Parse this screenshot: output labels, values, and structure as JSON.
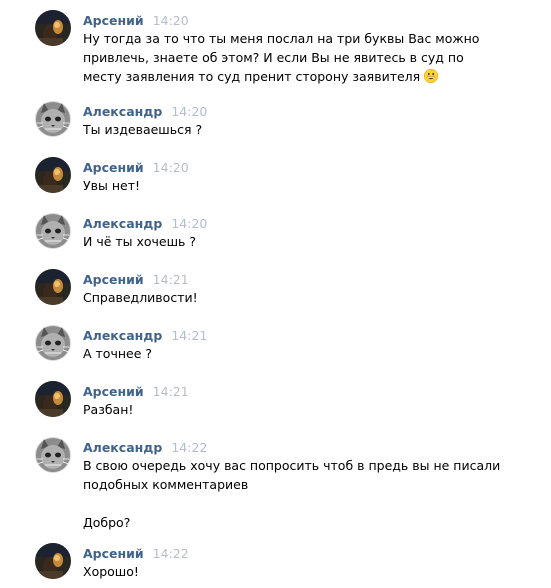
{
  "messages": [
    {
      "author": "Арсений",
      "avatar": "arseniy",
      "time": "14:20",
      "lines": [
        "Ну тогда за то что ты меня послал на три буквы Вас можно",
        "привлечь, знаете об этом? И если Вы не явитесь в суд по",
        "месту заявления то суд пренит сторону заявителя"
      ],
      "emoji": "grinning-face-emoji"
    },
    {
      "author": "Александр",
      "avatar": "aleksandr",
      "time": "14:20",
      "lines": [
        "Ты издеваешься ?"
      ]
    },
    {
      "author": "Арсений",
      "avatar": "arseniy",
      "time": "14:20",
      "lines": [
        "Увы нет!"
      ]
    },
    {
      "author": "Александр",
      "avatar": "aleksandr",
      "time": "14:20",
      "lines": [
        "И чё ты хочешь ?"
      ]
    },
    {
      "author": "Арсений",
      "avatar": "arseniy",
      "time": "14:21",
      "lines": [
        "Справедливости!"
      ]
    },
    {
      "author": "Александр",
      "avatar": "aleksandr",
      "time": "14:21",
      "lines": [
        "А точнее ?"
      ]
    },
    {
      "author": "Арсений",
      "avatar": "arseniy",
      "time": "14:21",
      "lines": [
        "Разбан!"
      ]
    },
    {
      "author": "Александр",
      "avatar": "aleksandr",
      "time": "14:22",
      "lines": [
        "В свою очередь хочу вас попросить чтоб в предь вы не писали",
        "подобных комментариев",
        "",
        "Добро?"
      ]
    },
    {
      "author": "Арсений",
      "avatar": "arseniy",
      "time": "14:22",
      "lines": [
        "Хорошо!"
      ]
    }
  ],
  "colors": {
    "author_name": "#42648b",
    "timestamp": "#b4bfcb",
    "text": "#000000",
    "background": "#ffffff"
  }
}
